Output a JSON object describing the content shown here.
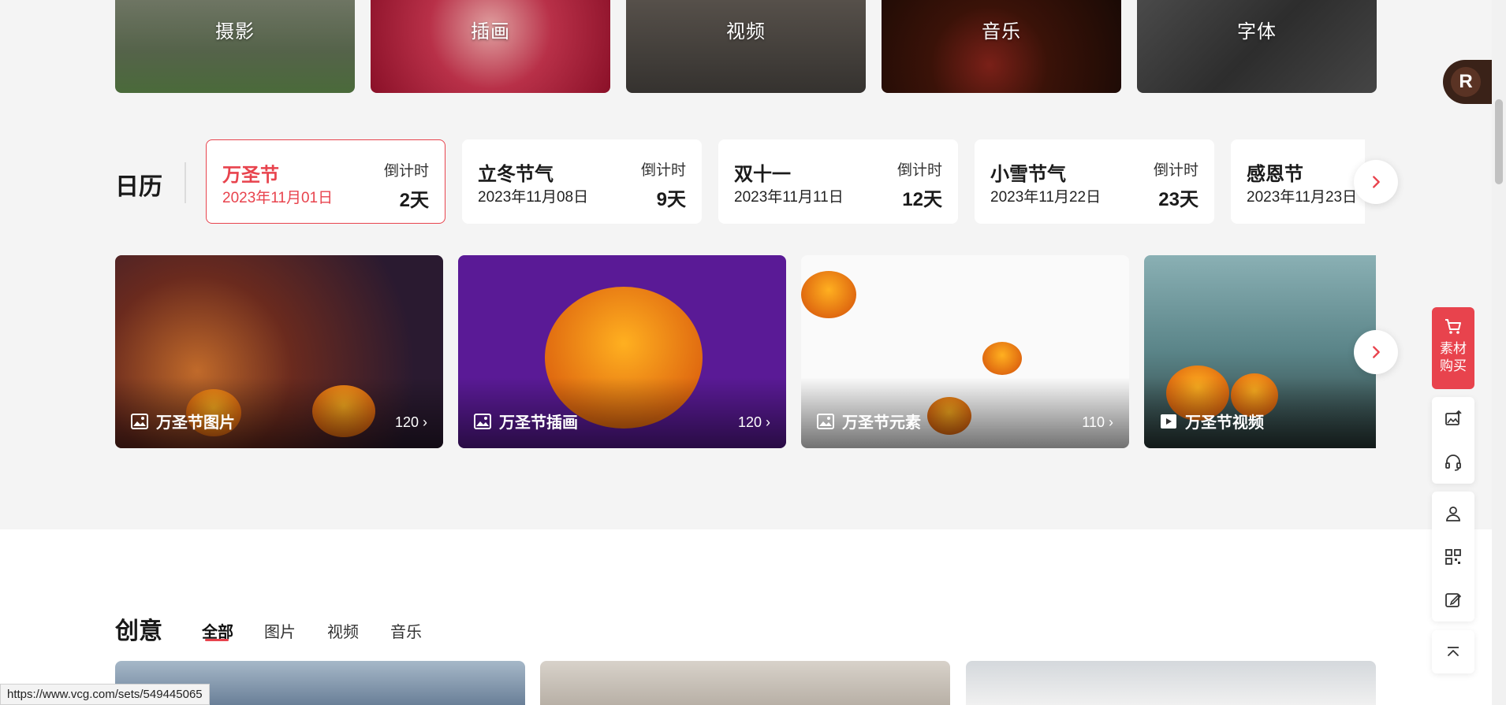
{
  "categories": [
    {
      "label": "摄影"
    },
    {
      "label": "插画"
    },
    {
      "label": "视频"
    },
    {
      "label": "音乐"
    },
    {
      "label": "字体"
    }
  ],
  "avatar": {
    "letter": "R"
  },
  "calendar": {
    "title": "日历",
    "countdown_label": "倒计时",
    "items": [
      {
        "name": "万圣节",
        "date": "2023年11月01日",
        "countdown": "2天"
      },
      {
        "name": "立冬节气",
        "date": "2023年11月08日",
        "countdown": "9天"
      },
      {
        "name": "双十一",
        "date": "2023年11月11日",
        "countdown": "12天"
      },
      {
        "name": "小雪节气",
        "date": "2023年11月22日",
        "countdown": "23天"
      },
      {
        "name": "感恩节",
        "date": "2023年11月23日",
        "countdown": ""
      }
    ]
  },
  "collections": [
    {
      "label": "万圣节图片",
      "count": "120 ›",
      "icon": "image-icon"
    },
    {
      "label": "万圣节插画",
      "count": "120 ›",
      "icon": "image-icon"
    },
    {
      "label": "万圣节元素",
      "count": "110 ›",
      "icon": "image-icon"
    },
    {
      "label": "万圣节视频",
      "count": "",
      "icon": "play-icon"
    }
  ],
  "creative": {
    "title": "创意",
    "tabs": [
      {
        "label": "全部"
      },
      {
        "label": "图片"
      },
      {
        "label": "视频"
      },
      {
        "label": "音乐"
      }
    ]
  },
  "float_toolbar": {
    "buy_label_line1": "素材",
    "buy_label_line2": "购买"
  },
  "status_url": "https://www.vcg.com/sets/549445065",
  "colors": {
    "accent": "#e8434d"
  }
}
